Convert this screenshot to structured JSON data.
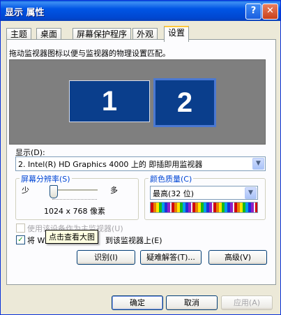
{
  "window": {
    "title": "显示 属性",
    "help_icon": "?",
    "close_icon": "✕"
  },
  "tabs": [
    {
      "label": "主题",
      "active": false
    },
    {
      "label": "桌面",
      "active": false
    },
    {
      "label": "屏幕保护程序",
      "active": false
    },
    {
      "label": "外观",
      "active": false
    },
    {
      "label": "设置",
      "active": true
    }
  ],
  "settings": {
    "description": "拖动监视器图标以便与监视器的物理设置匹配。",
    "monitors": [
      "1",
      "2"
    ],
    "display_label": "显示(D):",
    "display_value": "2. Intel(R) HD Graphics 4000 上的 即插即用监视器",
    "resolution": {
      "title": "屏幕分辨率(S)",
      "low": "少",
      "high": "多",
      "value": "1024 x 768 像素"
    },
    "color": {
      "title": "颜色质量(C)",
      "value": "最高(32 位)"
    },
    "primary_checkbox": {
      "label": "使用该设备作为主监视器(U)",
      "checked": false
    },
    "extend_checkbox": {
      "label_prefix": "将 Wi",
      "label_suffix": "到该监视器上(E)",
      "checked": true
    },
    "tooltip": "点击查看大图",
    "buttons": {
      "identify": "识别(I)",
      "troubleshoot": "疑难解答(T)...",
      "advanced": "高级(V)"
    }
  },
  "footer": {
    "ok": "确定",
    "cancel": "取消",
    "apply": "应用(A)"
  }
}
